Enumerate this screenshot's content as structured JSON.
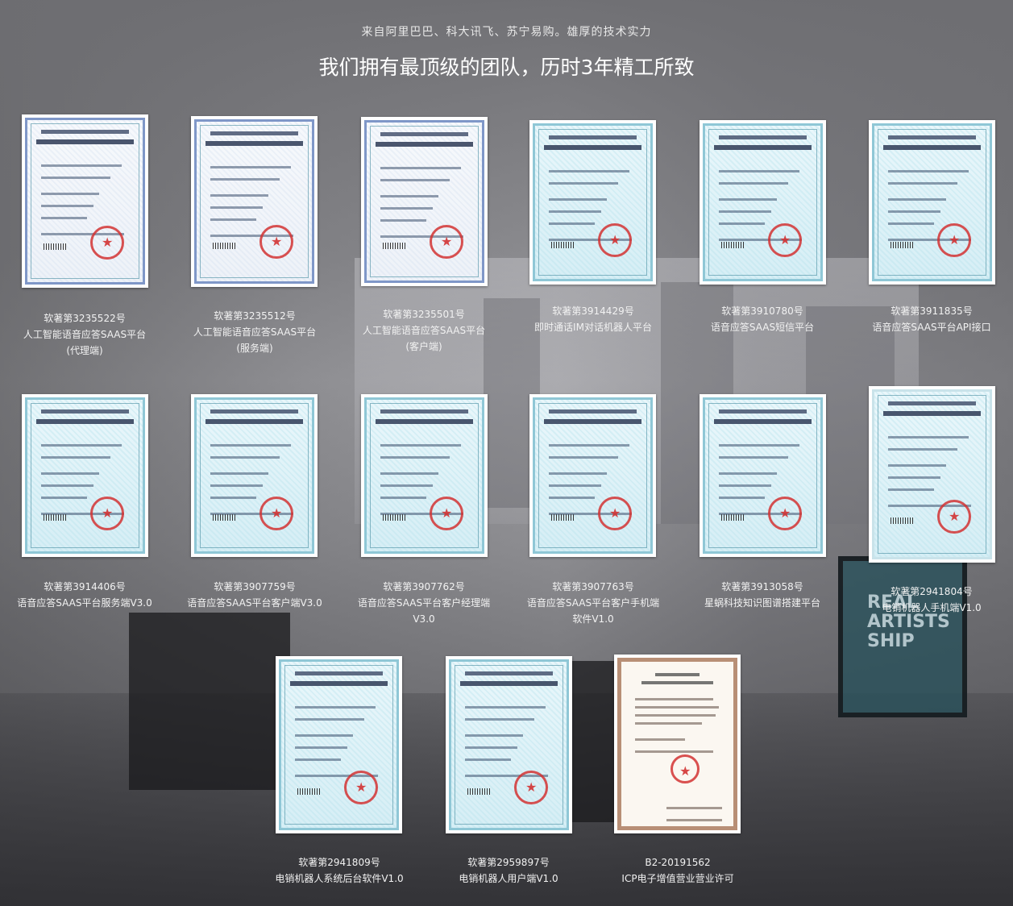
{
  "header": {
    "subtitle": "来自阿里巴巴、科大讯飞、苏宁易购。雄厚的技术实力",
    "title": "我们拥有最顶级的团队，历时3年精工所致"
  },
  "certificates": [
    {
      "number": "软著第3235522号",
      "name": "人工智能语音应答SAAS平台",
      "name2": "(代理端)"
    },
    {
      "number": "软著第3235512号",
      "name": "人工智能语音应答SAAS平台",
      "name2": "(服务端)"
    },
    {
      "number": "软著第3235501号",
      "name": "人工智能语音应答SAAS平台",
      "name2": "(客户端)"
    },
    {
      "number": "软著第3914429号",
      "name": "即时通话IM对话机器人平台",
      "name2": ""
    },
    {
      "number": "软著第3910780号",
      "name": "语音应答SAAS短信平台",
      "name2": ""
    },
    {
      "number": "软著第3911835号",
      "name": "语音应答SAAS平台API接口",
      "name2": ""
    },
    {
      "number": "软著第3914406号",
      "name": "语音应答SAAS平台服务端V3.0",
      "name2": ""
    },
    {
      "number": "软著第3907759号",
      "name": "语音应答SAAS平台客户端V3.0",
      "name2": ""
    },
    {
      "number": "软著第3907762号",
      "name": "语音应答SAAS平台客户经理端",
      "name2": "V3.0"
    },
    {
      "number": "软著第3907763号",
      "name": "语音应答SAAS平台客户手机端",
      "name2": "软件V1.0"
    },
    {
      "number": "软著第3913058号",
      "name": "星蜗科技知识图谱搭建平台",
      "name2": ""
    },
    {
      "number": "软著第2941804号",
      "name": "电销机器人手机端V1.0",
      "name2": ""
    },
    {
      "number": "软著第2941809号",
      "name": "电销机器人系统后台软件V1.0",
      "name2": ""
    },
    {
      "number": "软著第2959897号",
      "name": "电销机器人用户端V1.0",
      "name2": ""
    },
    {
      "number": "B2-20191562",
      "name": "ICP电子增值营业营业许可",
      "name2": ""
    }
  ]
}
